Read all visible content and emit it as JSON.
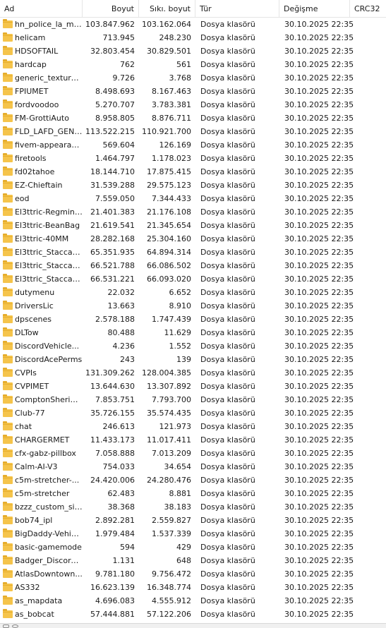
{
  "columns": {
    "name": "Ad",
    "size": "Boyut",
    "packed": "Sıkı. boyut",
    "type": "Tür",
    "modified": "Değişme",
    "crc": "CRC32"
  },
  "rows": [
    {
      "name": "hn_police_la_me...",
      "size": "103.847.962",
      "packed": "103.162.064",
      "type": "Dosya klasörü",
      "modified": "30.10.2025 22:35"
    },
    {
      "name": "helicam",
      "size": "713.945",
      "packed": "248.230",
      "type": "Dosya klasörü",
      "modified": "30.10.2025 22:35"
    },
    {
      "name": "HDSOFTAIL",
      "size": "32.803.454",
      "packed": "30.829.501",
      "type": "Dosya klasörü",
      "modified": "30.10.2025 22:35"
    },
    {
      "name": "hardcap",
      "size": "762",
      "packed": "561",
      "type": "Dosya klasörü",
      "modified": "30.10.2025 22:35"
    },
    {
      "name": "generic_texture_...",
      "size": "9.726",
      "packed": "3.768",
      "type": "Dosya klasörü",
      "modified": "30.10.2025 22:35"
    },
    {
      "name": "FPIUMET",
      "size": "8.498.693",
      "packed": "8.167.463",
      "type": "Dosya klasörü",
      "modified": "30.10.2025 22:35"
    },
    {
      "name": "fordvoodoo",
      "size": "5.270.707",
      "packed": "3.783.381",
      "type": "Dosya klasörü",
      "modified": "30.10.2025 22:35"
    },
    {
      "name": "FM-GrottiAuto",
      "size": "8.958.805",
      "packed": "8.876.711",
      "type": "Dosya klasörü",
      "modified": "30.10.2025 22:35"
    },
    {
      "name": "FLD_LAFD_GENE...",
      "size": "113.522.215",
      "packed": "110.921.700",
      "type": "Dosya klasörü",
      "modified": "30.10.2025 22:35"
    },
    {
      "name": "fivem-appearance",
      "size": "569.604",
      "packed": "126.169",
      "type": "Dosya klasörü",
      "modified": "30.10.2025 22:35"
    },
    {
      "name": "firetools",
      "size": "1.464.797",
      "packed": "1.178.023",
      "type": "Dosya klasörü",
      "modified": "30.10.2025 22:35"
    },
    {
      "name": "fd02tahoe",
      "size": "18.144.710",
      "packed": "17.875.415",
      "type": "Dosya klasörü",
      "modified": "30.10.2025 22:35"
    },
    {
      "name": "EZ-Chieftain",
      "size": "31.539.288",
      "packed": "29.575.123",
      "type": "Dosya klasörü",
      "modified": "30.10.2025 22:35"
    },
    {
      "name": "eod",
      "size": "7.559.050",
      "packed": "7.344.433",
      "type": "Dosya klasörü",
      "modified": "30.10.2025 22:35"
    },
    {
      "name": "El3ttric-Regmint...",
      "size": "21.401.383",
      "packed": "21.176.108",
      "type": "Dosya klasörü",
      "modified": "30.10.2025 22:35"
    },
    {
      "name": "El3ttric-BeanBag",
      "size": "21.619.541",
      "packed": "21.345.654",
      "type": "Dosya klasörü",
      "modified": "30.10.2025 22:35"
    },
    {
      "name": "El3ttric-40MM",
      "size": "28.282.168",
      "packed": "25.304.160",
      "type": "Dosya klasörü",
      "modified": "30.10.2025 22:35"
    },
    {
      "name": "El3ttric_Staccato...",
      "size": "65.351.935",
      "packed": "64.894.314",
      "type": "Dosya klasörü",
      "modified": "30.10.2025 22:35"
    },
    {
      "name": "El3ttric_Staccato...",
      "size": "66.521.788",
      "packed": "66.086.502",
      "type": "Dosya klasörü",
      "modified": "30.10.2025 22:35"
    },
    {
      "name": "El3ttric_Staccato...",
      "size": "66.531.221",
      "packed": "66.093.020",
      "type": "Dosya klasörü",
      "modified": "30.10.2025 22:35"
    },
    {
      "name": "dutymenu",
      "size": "22.032",
      "packed": "6.652",
      "type": "Dosya klasörü",
      "modified": "30.10.2025 22:35"
    },
    {
      "name": "DriversLic",
      "size": "13.663",
      "packed": "8.910",
      "type": "Dosya klasörü",
      "modified": "30.10.2025 22:35"
    },
    {
      "name": "dpscenes",
      "size": "2.578.188",
      "packed": "1.747.439",
      "type": "Dosya klasörü",
      "modified": "30.10.2025 22:35"
    },
    {
      "name": "DLTow",
      "size": "80.488",
      "packed": "11.629",
      "type": "Dosya klasörü",
      "modified": "30.10.2025 22:35"
    },
    {
      "name": "DiscordVehicle...",
      "size": "4.236",
      "packed": "1.552",
      "type": "Dosya klasörü",
      "modified": "30.10.2025 22:35"
    },
    {
      "name": "DiscordAcePerms",
      "size": "243",
      "packed": "139",
      "type": "Dosya klasörü",
      "modified": "30.10.2025 22:35"
    },
    {
      "name": "CVPIs",
      "size": "131.309.262",
      "packed": "128.004.385",
      "type": "Dosya klasörü",
      "modified": "30.10.2025 22:35"
    },
    {
      "name": "CVPIMET",
      "size": "13.644.630",
      "packed": "13.307.892",
      "type": "Dosya klasörü",
      "modified": "30.10.2025 22:35"
    },
    {
      "name": "ComptonSheriff...",
      "size": "7.853.751",
      "packed": "7.793.700",
      "type": "Dosya klasörü",
      "modified": "30.10.2025 22:35"
    },
    {
      "name": "Club-77",
      "size": "35.726.155",
      "packed": "35.574.435",
      "type": "Dosya klasörü",
      "modified": "30.10.2025 22:35"
    },
    {
      "name": "chat",
      "size": "246.613",
      "packed": "121.973",
      "type": "Dosya klasörü",
      "modified": "30.10.2025 22:35"
    },
    {
      "name": "CHARGERMET",
      "size": "11.433.173",
      "packed": "11.017.411",
      "type": "Dosya klasörü",
      "modified": "30.10.2025 22:35"
    },
    {
      "name": "cfx-gabz-pillbox",
      "size": "7.058.888",
      "packed": "7.013.209",
      "type": "Dosya klasörü",
      "modified": "30.10.2025 22:35"
    },
    {
      "name": "Calm-AI-V3",
      "size": "754.033",
      "packed": "34.654",
      "type": "Dosya klasörü",
      "modified": "30.10.2025 22:35"
    },
    {
      "name": "c5m-stretcher-...",
      "size": "24.420.006",
      "packed": "24.280.476",
      "type": "Dosya klasörü",
      "modified": "30.10.2025 22:35"
    },
    {
      "name": "c5m-stretcher",
      "size": "62.483",
      "packed": "8.881",
      "type": "Dosya klasörü",
      "modified": "30.10.2025 22:35"
    },
    {
      "name": "bzzz_custom_sig...",
      "size": "38.368",
      "packed": "38.183",
      "type": "Dosya klasörü",
      "modified": "30.10.2025 22:35"
    },
    {
      "name": "bob74_ipl",
      "size": "2.892.281",
      "packed": "2.559.827",
      "type": "Dosya klasörü",
      "modified": "30.10.2025 22:35"
    },
    {
      "name": "BigDaddy-Vehicl...",
      "size": "1.979.484",
      "packed": "1.537.339",
      "type": "Dosya klasörü",
      "modified": "30.10.2025 22:35"
    },
    {
      "name": "basic-gamemode",
      "size": "594",
      "packed": "429",
      "type": "Dosya klasörü",
      "modified": "30.10.2025 22:35"
    },
    {
      "name": "Badger_Discord_...",
      "size": "1.131",
      "packed": "648",
      "type": "Dosya klasörü",
      "modified": "30.10.2025 22:35"
    },
    {
      "name": "AtlasDowntown...",
      "size": "9.781.180",
      "packed": "9.756.472",
      "type": "Dosya klasörü",
      "modified": "30.10.2025 22:35"
    },
    {
      "name": "AS332",
      "size": "16.623.139",
      "packed": "16.348.774",
      "type": "Dosya klasörü",
      "modified": "30.10.2025 22:35"
    },
    {
      "name": "as_mapdata",
      "size": "4.696.083",
      "packed": "4.555.912",
      "type": "Dosya klasörü",
      "modified": "30.10.2025 22:35"
    },
    {
      "name": "as_bobcat",
      "size": "57.444.881",
      "packed": "57.122.206",
      "type": "Dosya klasörü",
      "modified": "30.10.2025 22:35"
    }
  ]
}
